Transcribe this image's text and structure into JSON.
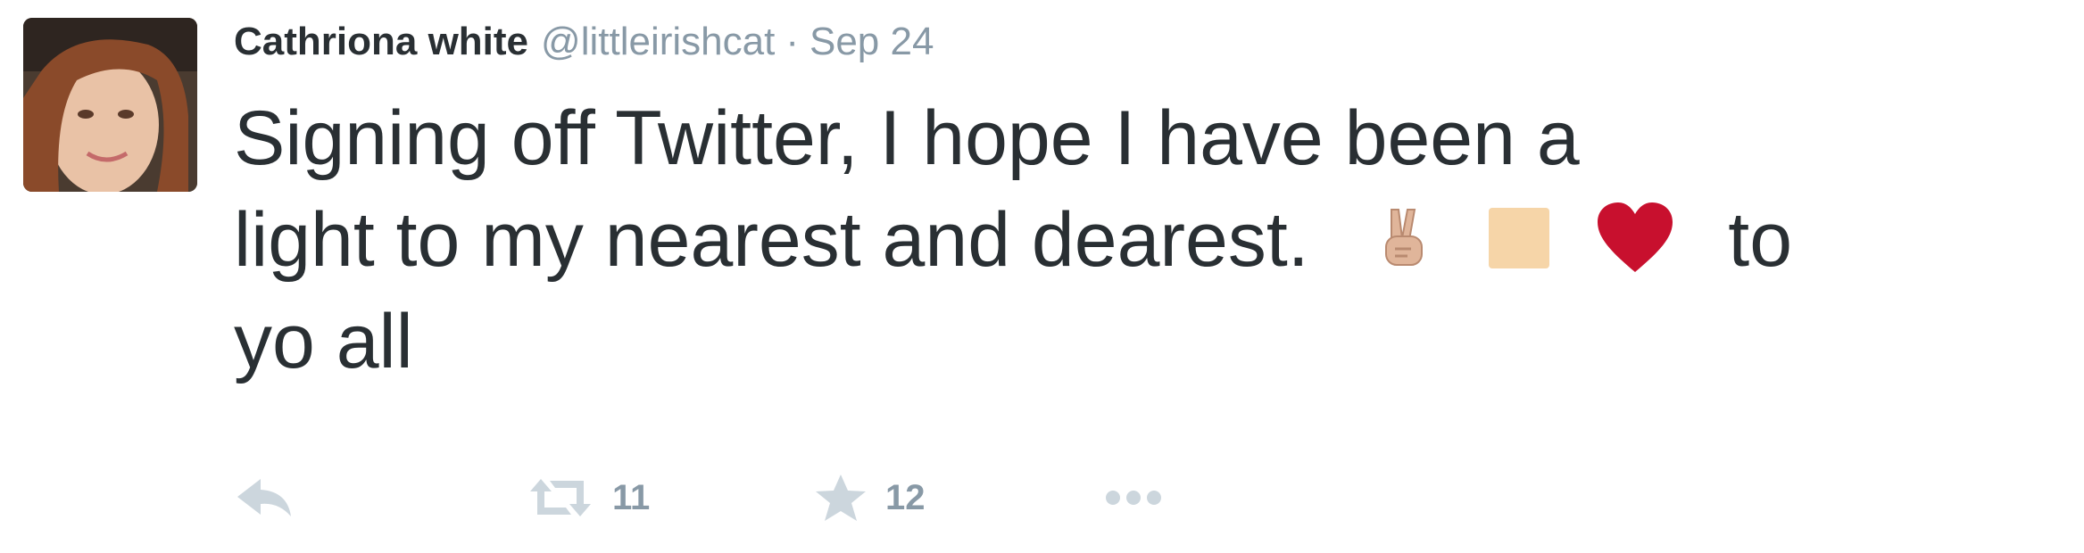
{
  "tweet": {
    "author": {
      "name": "Cathriona white",
      "handle": "@littleirishcat"
    },
    "separator": "·",
    "date": "Sep 24",
    "text_lines": [
      "Signing off Twitter, I hope I have been a",
      "light to my nearest and dearest.",
      "to",
      "yo all"
    ],
    "stats": {
      "retweets": "11",
      "favorites": "12"
    },
    "icons": {
      "emoji": [
        "victory-hand-emoji",
        "blank-square-emoji",
        "red-heart-emoji"
      ],
      "actions": [
        "reply-icon",
        "retweet-icon",
        "star-icon",
        "more-icon"
      ]
    },
    "colors": {
      "text": "#292f33",
      "muted": "#8899a6",
      "icon": "#ccd6dd",
      "heart": "#c8102e",
      "square": "#f6d5a8",
      "hand": "#e0b59a"
    }
  }
}
